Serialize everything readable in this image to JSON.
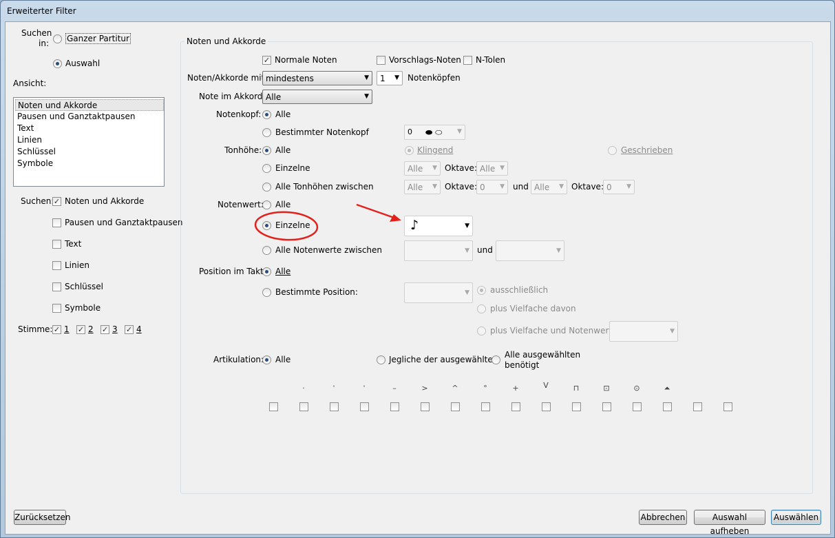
{
  "window": {
    "title": "Erweiterter Filter"
  },
  "left": {
    "suchen_in_label": "Suchen in:",
    "radio_ganzer": "Ganzer Partitur",
    "radio_auswahl": "Auswahl",
    "ansicht_label": "Ansicht:",
    "list_items": [
      "Noten und Akkorde",
      "Pausen und Ganztaktpausen",
      "Text",
      "Linien",
      "Schlüssel",
      "Symbole"
    ],
    "suchen_label": "Suchen:",
    "suchen_checks": [
      {
        "label": "Noten und Akkorde",
        "checked": true
      },
      {
        "label": "Pausen und Ganztaktpausen",
        "checked": false
      },
      {
        "label": "Text",
        "checked": false
      },
      {
        "label": "Linien",
        "checked": false
      },
      {
        "label": "Schlüssel",
        "checked": false
      },
      {
        "label": "Symbole",
        "checked": false
      }
    ],
    "stimme_label": "Stimme:",
    "stimmen": [
      "1",
      "2",
      "3",
      "4"
    ]
  },
  "group": {
    "title": "Noten und Akkorde",
    "cb_normale": "Normale Noten",
    "cb_vorschlag": "Vorschlags-Noten",
    "cb_ntolen": "N-Tolen",
    "noten_mit_label": "Noten/Akkorde mit",
    "noten_mit_value": "mindestens",
    "count_value": "1",
    "notenkoepfen": "Notenköpfen",
    "note_im_akkord_label": "Note im Akkord:",
    "note_im_akkord_value": "Alle",
    "notenkopf_label": "Notenkopf:",
    "alle": "Alle",
    "bestimmter_notenkopf": "Bestimmter Notenkopf",
    "notenkopf_combo": "0",
    "tonhoehe_label": "Tonhöhe:",
    "klingend": "Klingend",
    "geschrieben": "Geschrieben",
    "einzelne": "Einzelne",
    "oktave": "Oktave:",
    "alle_tonhoehen": "Alle Tonhöhen zwischen",
    "zero": "0",
    "und": "und",
    "notenwert_label": "Notenwert:",
    "alle_notenwerte": "Alle Notenwerte zwischen",
    "position_label": "Position im Takt:",
    "bestimmte_position": "Bestimmte Position:",
    "ausschliesslich": "ausschließlich",
    "plus_vielfache": "plus Vielfache davon",
    "plus_vielfache_notenwert": "plus Vielfache und Notenwert:",
    "artikulation_label": "Artikulation:",
    "jegliche": "Jegliche der ausgewählten",
    "alle_ausgewaehlten_1": "Alle ausgewählten",
    "alle_ausgewaehlten_2": "benötigt"
  },
  "buttons": {
    "reset": "Zurücksetzen",
    "cancel": "Abbrechen",
    "clear": "Auswahl aufheben",
    "select": "Auswählen"
  },
  "colors": {
    "annotation": "#e3201b",
    "accent": "#3c7fb1"
  }
}
